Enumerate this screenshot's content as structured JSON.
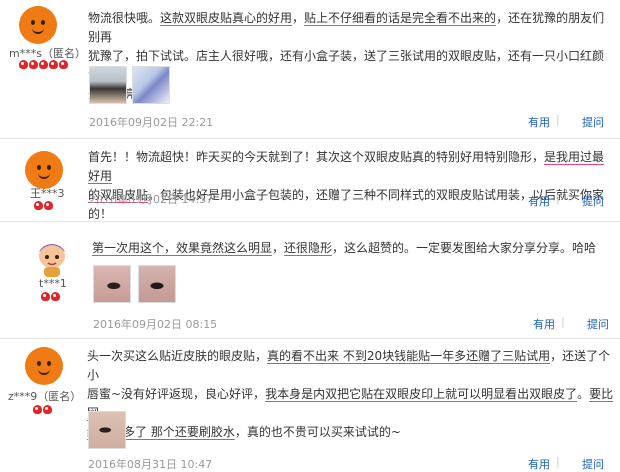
{
  "colors": {
    "link": "#1a60b5",
    "highlight_underline": "#e8447c",
    "heart": "#e0262a",
    "avatar": "#f07b15"
  },
  "reviews": [
    {
      "username": "m***s（匿名）",
      "hearts": 5,
      "lines": [
        "物流很快哦。这款双眼皮贴真心的好用，贴上不仔细看的话是完全看不出来的，还在犹豫的朋友们别再",
        "犹豫了，拍下试试。店主人很好哦，还有小盒子装，送了三张试用的双眼皮贴，还有一只小口红颜色也",
        "是很漂亮晶。"
      ],
      "photo_count": 2,
      "date": "2016年09月02日  22:21",
      "useful": "有用",
      "ask": "提问"
    },
    {
      "username": "王***3",
      "hearts": 2,
      "lines": [
        "首先！！物流超快！昨天买的今天就到了！其次这个双眼皮贴真的特别好用特别隐形，是我用过最好用",
        "的双眼皮贴。包装也好是用小盒子包装的，还赠了三种不同样式的双眼皮贴试用装，以后就买你家的！"
      ],
      "photo_count": 0,
      "date": "2016年09月02日  14:57",
      "useful": "有用",
      "ask": "提问"
    },
    {
      "username": "t***1",
      "hearts": 2,
      "lines": [
        "第一次用这个，效果竟然这么明显，还很隐形，这么超赞的。一定要发图给大家分享分享。哈哈"
      ],
      "photo_count": 2,
      "date": "2016年09月02日  08:15",
      "useful": "有用",
      "ask": "提问"
    },
    {
      "username": "z***9（匿名）",
      "hearts": 2,
      "lines": [
        "头一次买这么贴近皮肤的眼皮贴，真的看不出来 不到20块钱能贴一年多还赠了三贴试用，还送了个小",
        "唇蜜~没有好评返现，良心好评，我本身是内双把它贴在双眼皮印上就可以明显看出双眼皮了。要比网",
        "纱的好多了 那个还要刷胶水，真的也不贵可以买来试试的~"
      ],
      "photo_count": 1,
      "date": "2016年08月31日  10:47",
      "useful": "有用",
      "ask": "提问"
    }
  ]
}
